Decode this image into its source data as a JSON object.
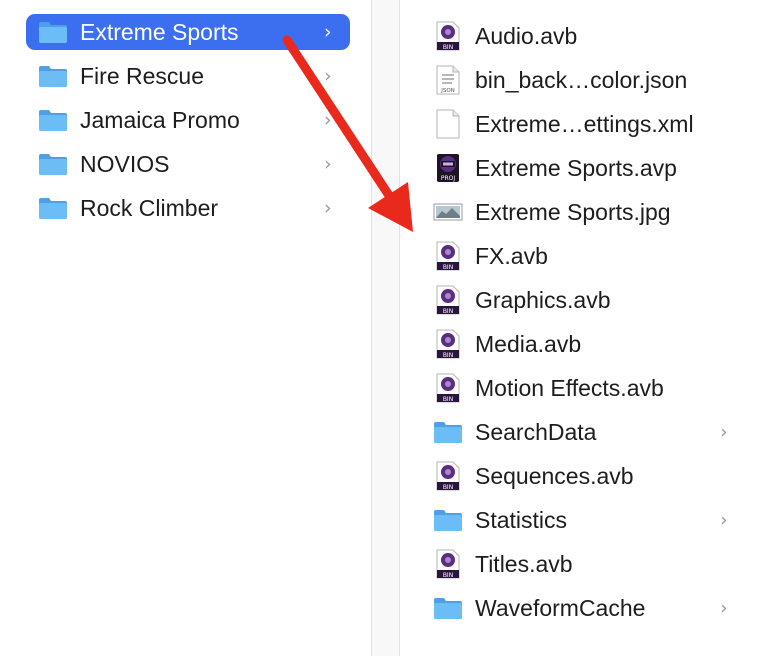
{
  "left_column": {
    "items": [
      {
        "label": "Extreme Sports",
        "icon": "folder-icon",
        "selected": true
      },
      {
        "label": "Fire Rescue",
        "icon": "folder-icon",
        "selected": false
      },
      {
        "label": "Jamaica Promo",
        "icon": "folder-icon",
        "selected": false
      },
      {
        "label": "NOVIOS",
        "icon": "folder-icon",
        "selected": false
      },
      {
        "label": "Rock Climber",
        "icon": "folder-icon",
        "selected": false
      }
    ],
    "chevron": "›"
  },
  "right_column": {
    "items": [
      {
        "label": "Audio.avb",
        "icon": "bin-file-icon"
      },
      {
        "label": "bin_back…color.json",
        "icon": "json-file-icon"
      },
      {
        "label": "Extreme…ettings.xml",
        "icon": "blank-file-icon"
      },
      {
        "label": "Extreme Sports.avp",
        "icon": "project-file-icon"
      },
      {
        "label": "Extreme Sports.jpg",
        "icon": "image-file-icon"
      },
      {
        "label": "FX.avb",
        "icon": "bin-file-icon"
      },
      {
        "label": "Graphics.avb",
        "icon": "bin-file-icon"
      },
      {
        "label": "Media.avb",
        "icon": "bin-file-icon"
      },
      {
        "label": "Motion Effects.avb",
        "icon": "bin-file-icon"
      },
      {
        "label": "SearchData",
        "icon": "folder-icon"
      },
      {
        "label": "Sequences.avb",
        "icon": "bin-file-icon"
      },
      {
        "label": "Statistics",
        "icon": "folder-icon"
      },
      {
        "label": "Titles.avb",
        "icon": "bin-file-icon"
      },
      {
        "label": "WaveformCache",
        "icon": "folder-icon"
      }
    ],
    "chevron": "›"
  },
  "icon_text": {
    "bin": "BIN",
    "json": "JSON",
    "proj": "PROJ"
  },
  "annotation": {
    "arrow_color": "#e8291c",
    "icon": "red-arrow-icon"
  },
  "colors": {
    "selection": "#3b6ff0",
    "folder": "#58aef0",
    "bin_icon": "#5a2d82"
  }
}
